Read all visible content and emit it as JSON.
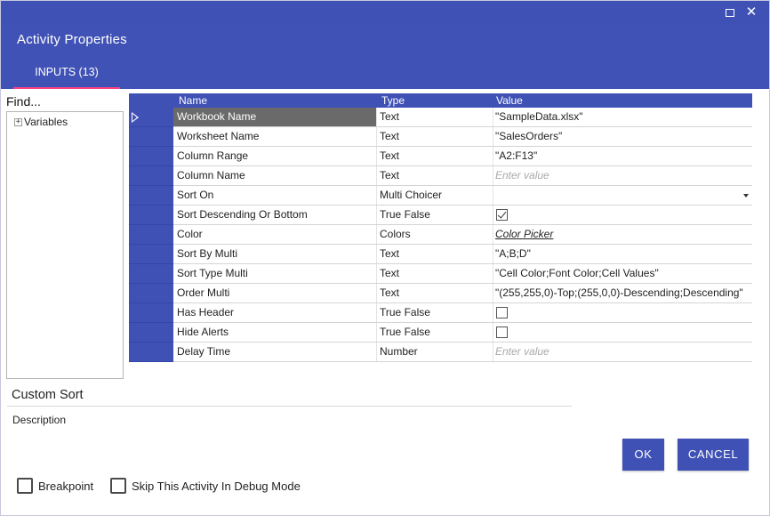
{
  "window": {
    "maximize_icon": "maximize-icon",
    "close_icon": "close-icon",
    "close_glyph": "✕"
  },
  "header": {
    "title": "Activity Properties",
    "tab_label": "INPUTS (13)"
  },
  "sidebar": {
    "find_label": "Find...",
    "tree": [
      {
        "label": "Variables",
        "expander": "⊞"
      }
    ]
  },
  "grid": {
    "columns": {
      "name": "Name",
      "type": "Type",
      "value": "Value"
    },
    "rows": [
      {
        "name": "Workbook Name",
        "type": "Text",
        "value": "\"SampleData.xlsx\"",
        "kind": "text"
      },
      {
        "name": "Worksheet Name",
        "type": "Text",
        "value": "\"SalesOrders\"",
        "kind": "text"
      },
      {
        "name": "Column Range",
        "type": "Text",
        "value": "\"A2:F13\"",
        "kind": "text"
      },
      {
        "name": "Column Name",
        "type": "Text",
        "value": "Enter value",
        "kind": "placeholder"
      },
      {
        "name": "Sort On",
        "type": "Multi Choicer",
        "value": "",
        "kind": "dropdown"
      },
      {
        "name": "Sort Descending Or Bottom",
        "type": "True False",
        "value": "true",
        "kind": "checkbox"
      },
      {
        "name": "Color",
        "type": "Colors",
        "value": "Color Picker",
        "kind": "link"
      },
      {
        "name": "Sort By Multi",
        "type": "Text",
        "value": "\"A;B;D\"",
        "kind": "text"
      },
      {
        "name": "Sort Type Multi",
        "type": "Text",
        "value": "\"Cell Color;Font Color;Cell Values\"",
        "kind": "text"
      },
      {
        "name": "Order Multi",
        "type": "Text",
        "value": "\"(255,255,0)-Top;(255,0,0)-Descending;Descending\"",
        "kind": "text"
      },
      {
        "name": "Has Header",
        "type": "True False",
        "value": "false",
        "kind": "checkbox"
      },
      {
        "name": "Hide Alerts",
        "type": "True False",
        "value": "false",
        "kind": "checkbox"
      },
      {
        "name": "Delay Time",
        "type": "Number",
        "value": "Enter value",
        "kind": "placeholder"
      }
    ]
  },
  "activity": {
    "name": "Custom Sort",
    "description_label": "Description"
  },
  "buttons": {
    "ok": "OK",
    "cancel": "CANCEL"
  },
  "options": {
    "breakpoint": "Breakpoint",
    "skip_debug": "Skip This Activity In Debug Mode"
  },
  "colors": {
    "primary": "#3f51b5",
    "accent": "#ff4081",
    "selected_row": "#6a6a6a"
  }
}
